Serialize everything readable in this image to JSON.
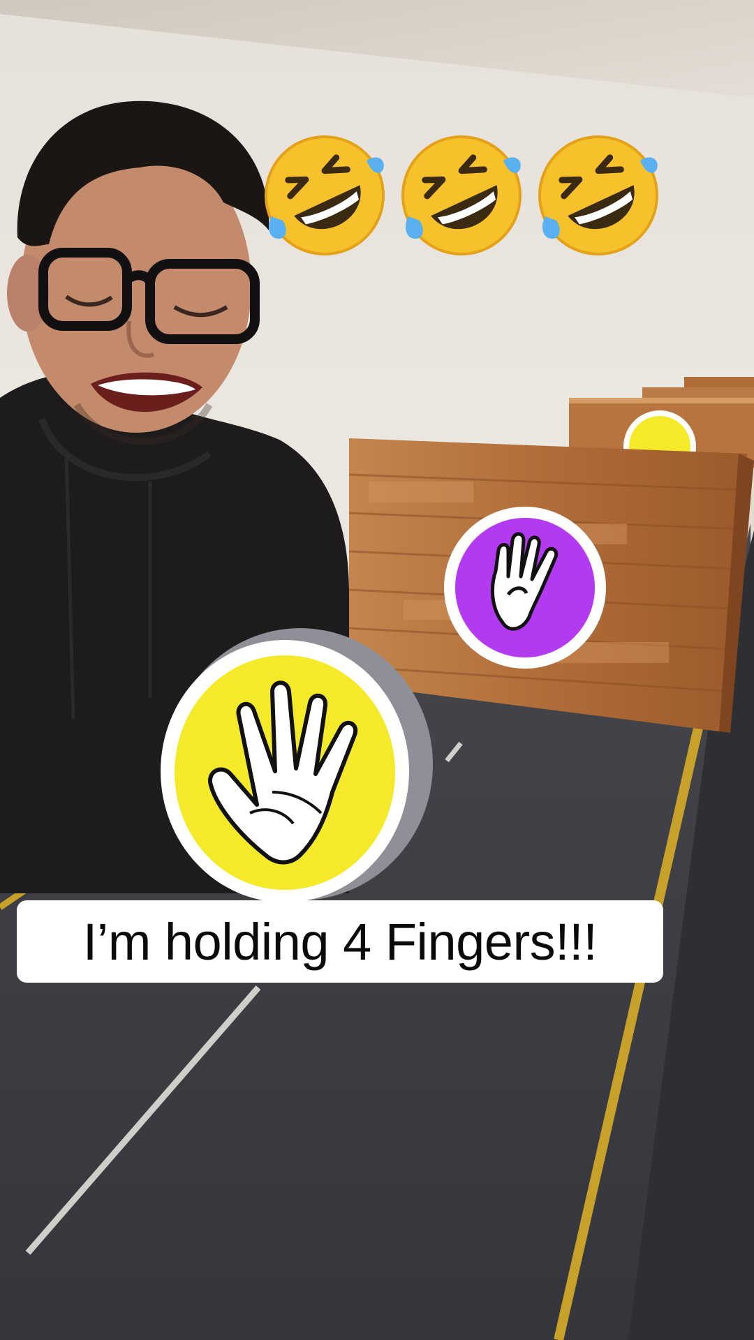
{
  "caption": {
    "text": "I’m holding 4 Fingers!!!"
  },
  "reaction_emojis": [
    {
      "icon": "rolling-on-floor-laughing-emoji"
    },
    {
      "icon": "rolling-on-floor-laughing-emoji"
    },
    {
      "icon": "rolling-on-floor-laughing-emoji"
    }
  ],
  "game": {
    "near_token": {
      "icon": "five-fingers-hand-icon",
      "color": "#f4ea2a",
      "fingers": 5
    },
    "far_token": {
      "icon": "four-fingers-hand-icon",
      "color": "#b23af0",
      "fingers": 4
    },
    "distant_token": {
      "icon": "hand-icon",
      "color": "#f4ea2a"
    }
  },
  "colors": {
    "track": "#3c3d42",
    "track_line_yellow": "#c7a12a",
    "track_line_white": "#c9c9c4",
    "wood": "#b5743f"
  }
}
